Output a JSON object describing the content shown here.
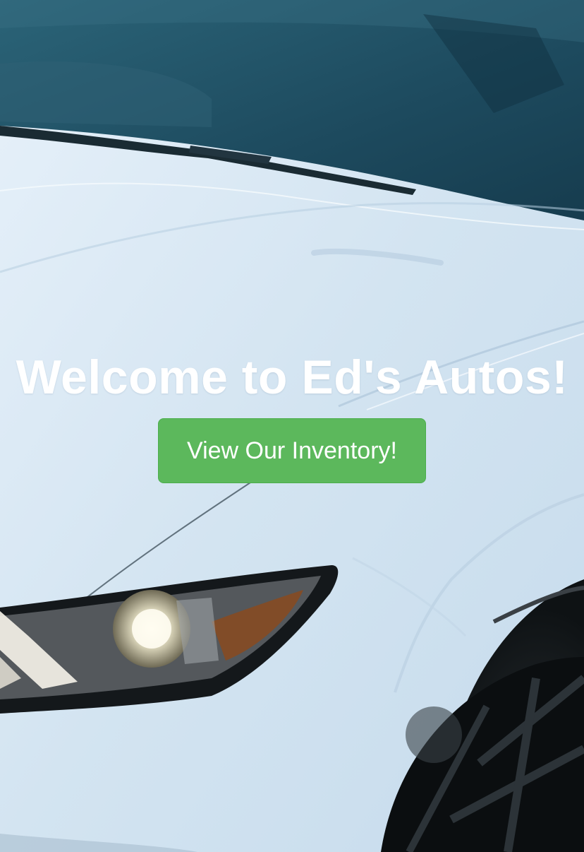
{
  "hero": {
    "title": "Welcome to Ed's Autos!",
    "background_image": "white-sports-car-hood-and-headlight",
    "cta_label": "View Our Inventory!"
  },
  "colors": {
    "cta_background": "#5cb85c",
    "cta_border": "#4cae4c",
    "title_text": "#ffffff",
    "windshield_tint": "#1f4f63",
    "car_body": "#dbe9f5"
  }
}
